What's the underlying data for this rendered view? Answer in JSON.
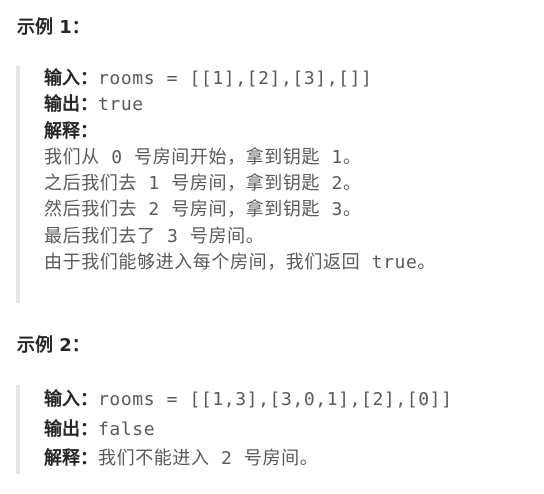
{
  "examples": [
    {
      "title": "示例 1：",
      "input_label": "输入：",
      "input_value": "rooms = [[1],[2],[3],[]]",
      "output_label": "输出：",
      "output_value": "true",
      "explanation_label": "解释：",
      "explanation_lines": [
        "我们从 0 号房间开始，拿到钥匙 1。",
        "之后我们去 1 号房间，拿到钥匙 2。",
        "然后我们去 2 号房间，拿到钥匙 3。",
        "最后我们去了 3 号房间。",
        "由于我们能够进入每个房间，我们返回 true。"
      ]
    },
    {
      "title": "示例 2：",
      "input_label": "输入：",
      "input_value": "rooms = [[1,3],[3,0,1],[2],[0]]",
      "output_label": "输出：",
      "output_value": "false",
      "explanation_label": "解释：",
      "explanation_text": "我们不能进入 2 号房间。"
    }
  ]
}
